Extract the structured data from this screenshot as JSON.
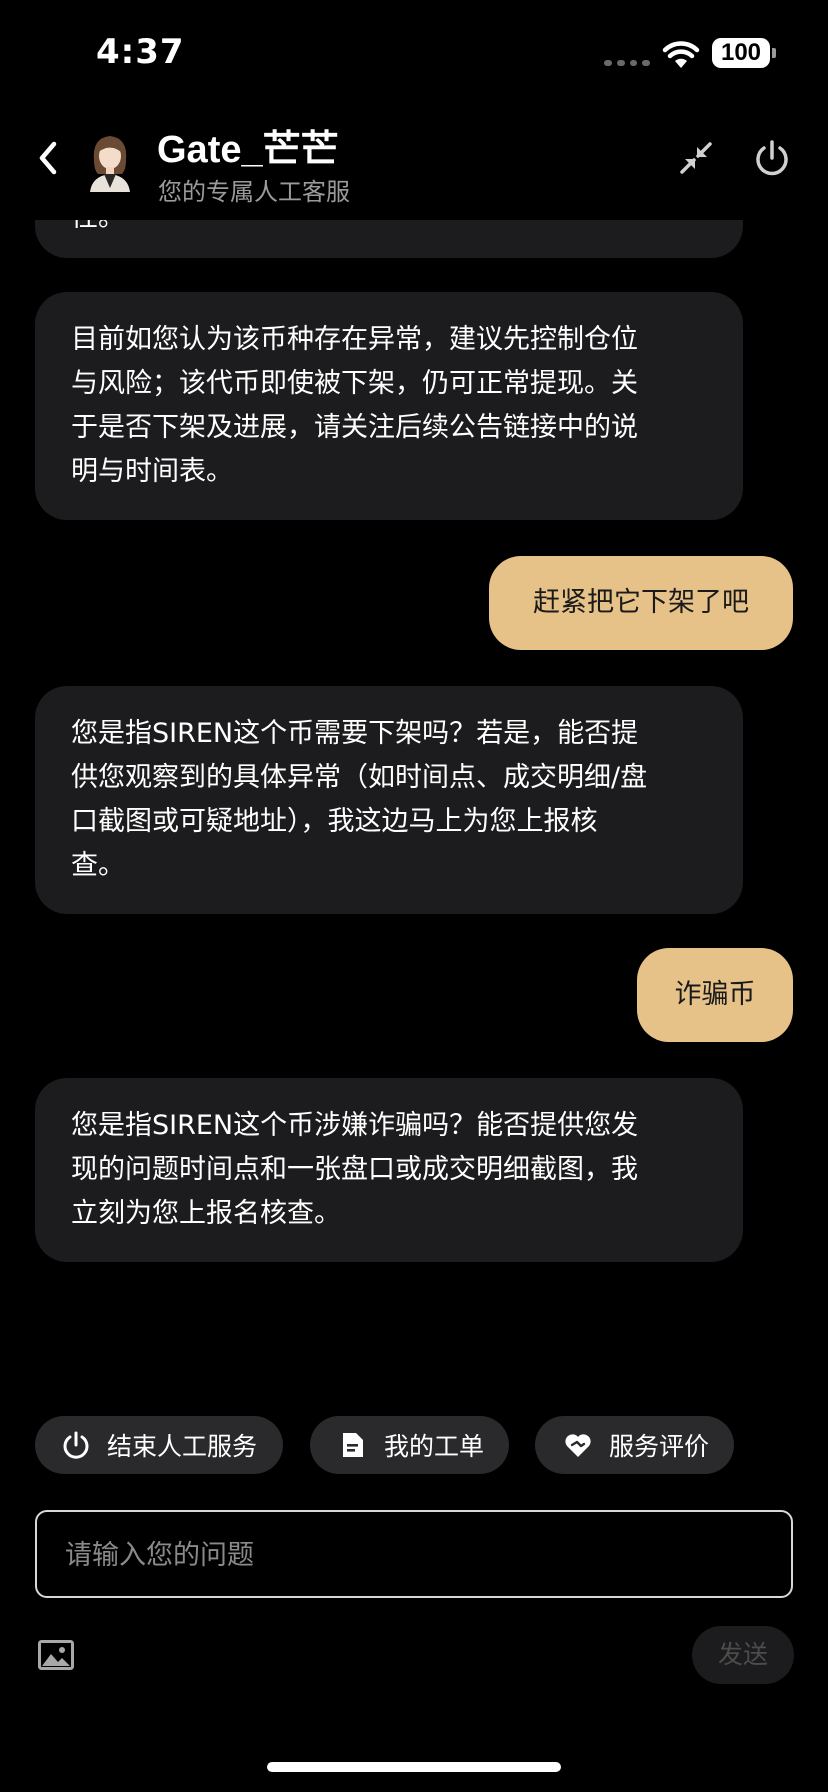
{
  "status_bar": {
    "time": "4:37",
    "battery": "100"
  },
  "header": {
    "agent_name": "Gate_芒芒",
    "subtitle": "您的专属人工客服",
    "back_icon": "chevron-left-icon",
    "minimize_icon": "collapse-arrows-icon",
    "power_icon": "power-icon"
  },
  "messages": [
    {
      "role": "agent",
      "text": "性。"
    },
    {
      "role": "agent",
      "text": "目前如您认为该币种存在异常，建议先控制仓位\n与风险；该代币即使被下架，仍可正常提现。关\n于是否下架及进展，请关注后续公告链接中的说\n明与时间表。"
    },
    {
      "role": "user",
      "text": "赶紧把它下架了吧"
    },
    {
      "role": "agent",
      "text": "您是指SIREN这个币需要下架吗？若是，能否提\n供您观察到的具体异常（如时间点、成交明细/盘\n口截图或可疑地址），我这边马上为您上报核\n查。"
    },
    {
      "role": "user",
      "text": "诈骗币"
    },
    {
      "role": "agent",
      "text": "您是指SIREN这个币涉嫌诈骗吗？能否提供您发\n现的问题时间点和一张盘口或成交明细截图，我\n立刻为您上报名核查。"
    }
  ],
  "actions": [
    {
      "label": "结束人工服务",
      "icon": "power-icon"
    },
    {
      "label": "我的工单",
      "icon": "document-icon"
    },
    {
      "label": "服务评价",
      "icon": "heart-handshake-icon"
    }
  ],
  "composer": {
    "placeholder": "请输入您的问题",
    "send_label": "发送",
    "image_icon": "image-icon"
  },
  "colors": {
    "background": "#000000",
    "agent_bubble": "#1c1c1e",
    "user_bubble": "#e6c289",
    "chip": "#2a2a2c"
  }
}
